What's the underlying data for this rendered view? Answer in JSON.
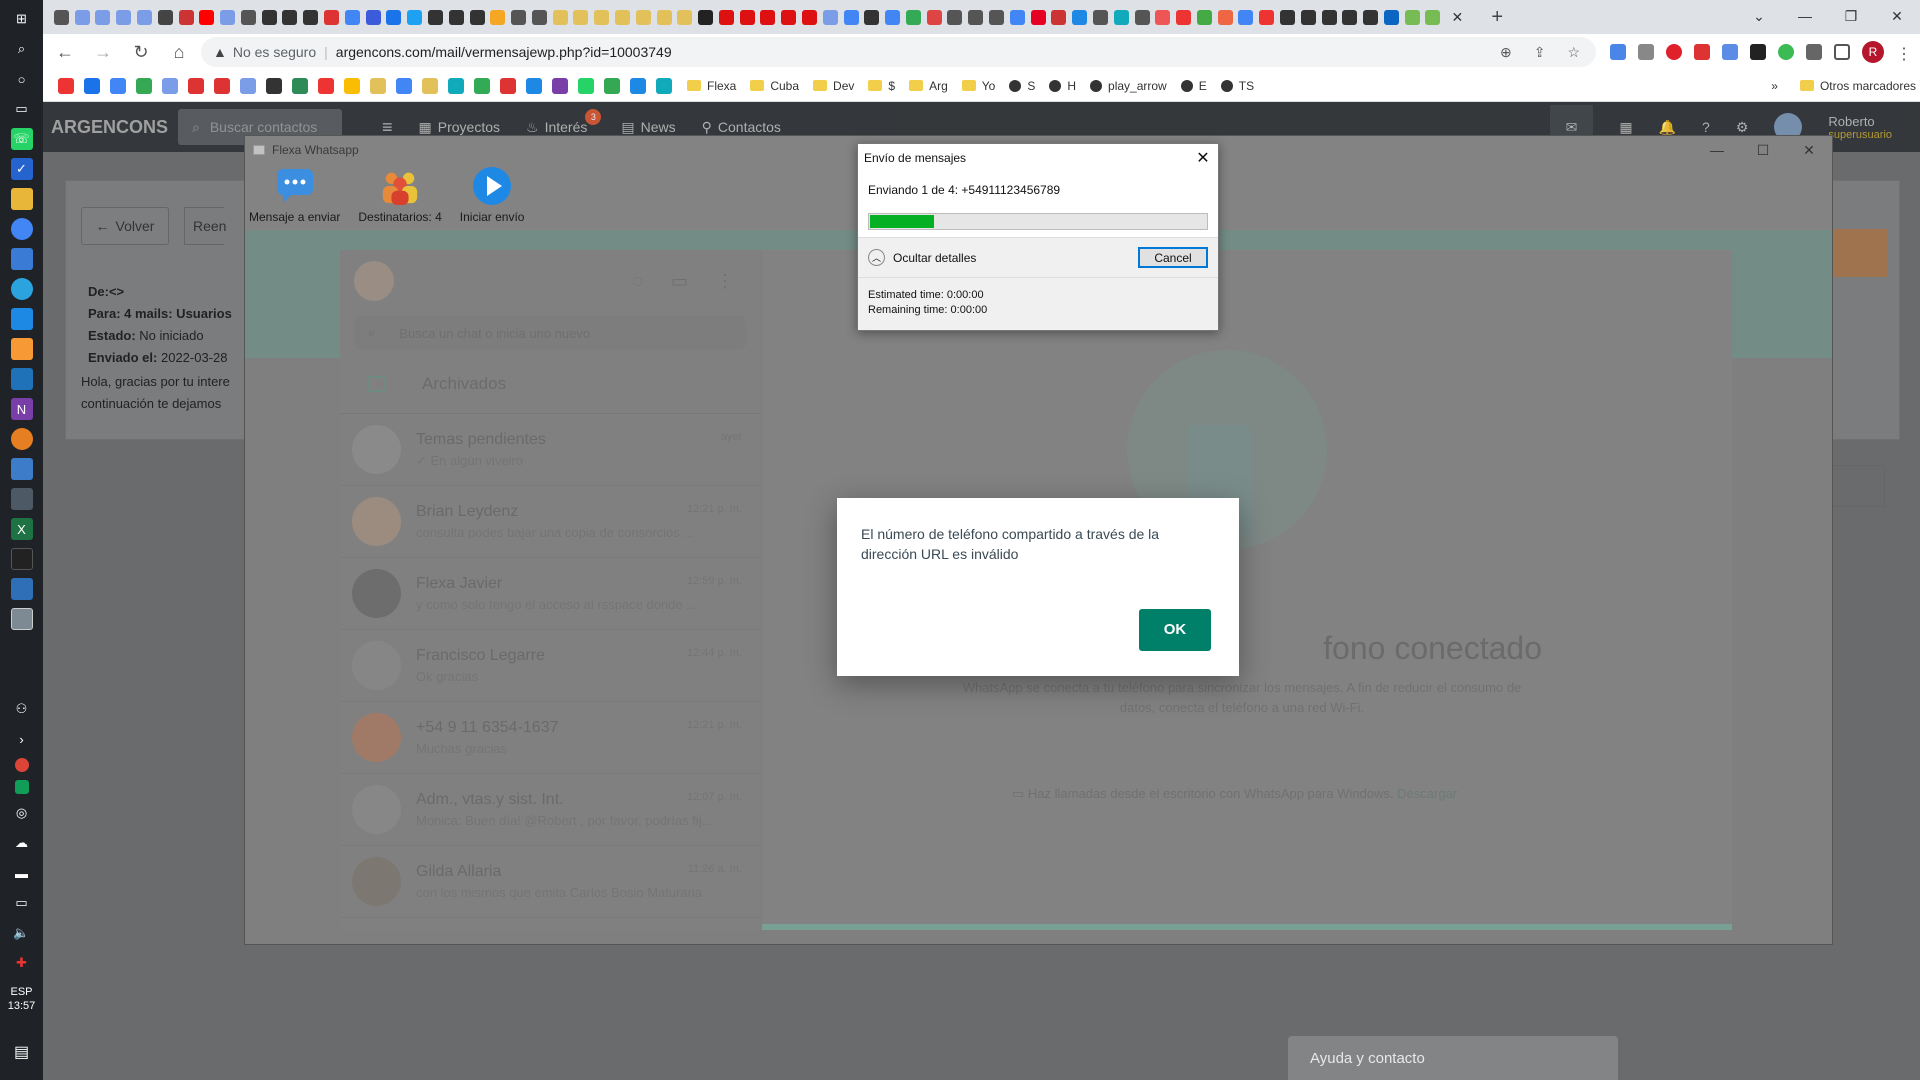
{
  "taskbar": {
    "language": "ESP",
    "clock": "13:57"
  },
  "browser": {
    "url_warning": "No es seguro",
    "url": "argencons.com/mail/vermensajewp.php?id=10003749",
    "profile_initial": "R",
    "bookmarks": [
      {
        "label": "Flexa"
      },
      {
        "label": "Cuba"
      },
      {
        "label": "Dev"
      },
      {
        "label": "$"
      },
      {
        "label": "Arg"
      },
      {
        "label": "Yo"
      },
      {
        "label": "S"
      },
      {
        "label": "H"
      },
      {
        "label": "play_arrow"
      },
      {
        "label": "E"
      },
      {
        "label": "TS"
      }
    ],
    "bookmarks_more": "»",
    "other_bookmarks": "Otros marcadores"
  },
  "app": {
    "logo": "ARGENCONS",
    "search_placeholder": "Buscar contactos",
    "nav": {
      "projects": "Proyectos",
      "interest": "Interés",
      "interest_badge": "3",
      "news": "News",
      "contacts": "Contactos"
    },
    "user_name": "Roberto",
    "user_role": "superusuario",
    "back_label": "Volver",
    "resend_label": "Reen",
    "meta": {
      "from_label": "De:",
      "from_value": "<>",
      "to_label": "Para:",
      "to_value": "4 mails: Usuarios",
      "status_label": "Estado:",
      "status_value": "No iniciado",
      "sent_label": "Enviado el:",
      "sent_value": "2022-03-28"
    },
    "message_line1": "Hola, gracias por tu intere",
    "message_line2": "continuación te dejamos",
    "help": "Ayuda y contacto"
  },
  "flexa": {
    "window_title": "Flexa Whatsapp",
    "tool_message": "Mensaje a enviar",
    "tool_recipients": "Destinatarios: 4",
    "tool_start": "Iniciar envío",
    "whatsapp": {
      "search_placeholder": "Busca un chat o inicia uno nuevo",
      "archived": "Archivados",
      "chats": [
        {
          "name": "Temas pendientes",
          "time": "ayer",
          "msg": "✓ En algún viveiro",
          "avatar_color": "#8a8a8a"
        },
        {
          "name": "Brian Leydenz",
          "time": "12:21 p. m.",
          "msg": "consulta podes bajar una copia de consorcios ...",
          "avatar_color": "#9c8c80"
        },
        {
          "name": "Flexa Javier",
          "time": "12:59 p. m.",
          "msg": "y como solo tengo el acceso al rsspace donde ...",
          "avatar_color": "#6d6d6d"
        },
        {
          "name": "Francisco Legarre",
          "time": "12:44 p. m.",
          "msg": "Ok gracias",
          "avatar_color": "#868686"
        },
        {
          "name": "+54 9 11 6354-1637",
          "time": "12:21 p. m.",
          "msg": "Muchas gracias",
          "avatar_color": "#a07a66"
        },
        {
          "name": "Adm., vtas.y sist. Int.",
          "time": "12:07 p. m.",
          "msg": "Monica: Buen día! @Robert , por favor, podrías fij...",
          "avatar_color": "#878787"
        },
        {
          "name": "Gilda Allaria",
          "time": "11:26 a. m.",
          "msg": "con los mismos que emita Carlos Bosio Maturana",
          "avatar_color": "#7d7772"
        }
      ],
      "main_title": "fono conectado",
      "main_desc": "WhatsApp se conecta a tu teléfono para sincronizar los mensajes. A fin de reducir el consumo de datos, conecta el teléfono a una red Wi-Fi.",
      "footer_text": "Haz llamadas desde el escritorio con WhatsApp para Windows.",
      "footer_link": "Descargar"
    }
  },
  "progress_dialog": {
    "title": "Envío de mensajes",
    "status": "Enviando 1 de 4: +54911123456789",
    "progress_fraction": 0.19,
    "details_toggle": "Ocultar detalles",
    "cancel": "Cancel",
    "estimated": "Estimated time: 0:00:00",
    "remaining": "Remaining time: 0:00:00"
  },
  "alert_dialog": {
    "message": "El número de teléfono compartido a través de la dirección URL es inválido",
    "ok": "OK"
  }
}
